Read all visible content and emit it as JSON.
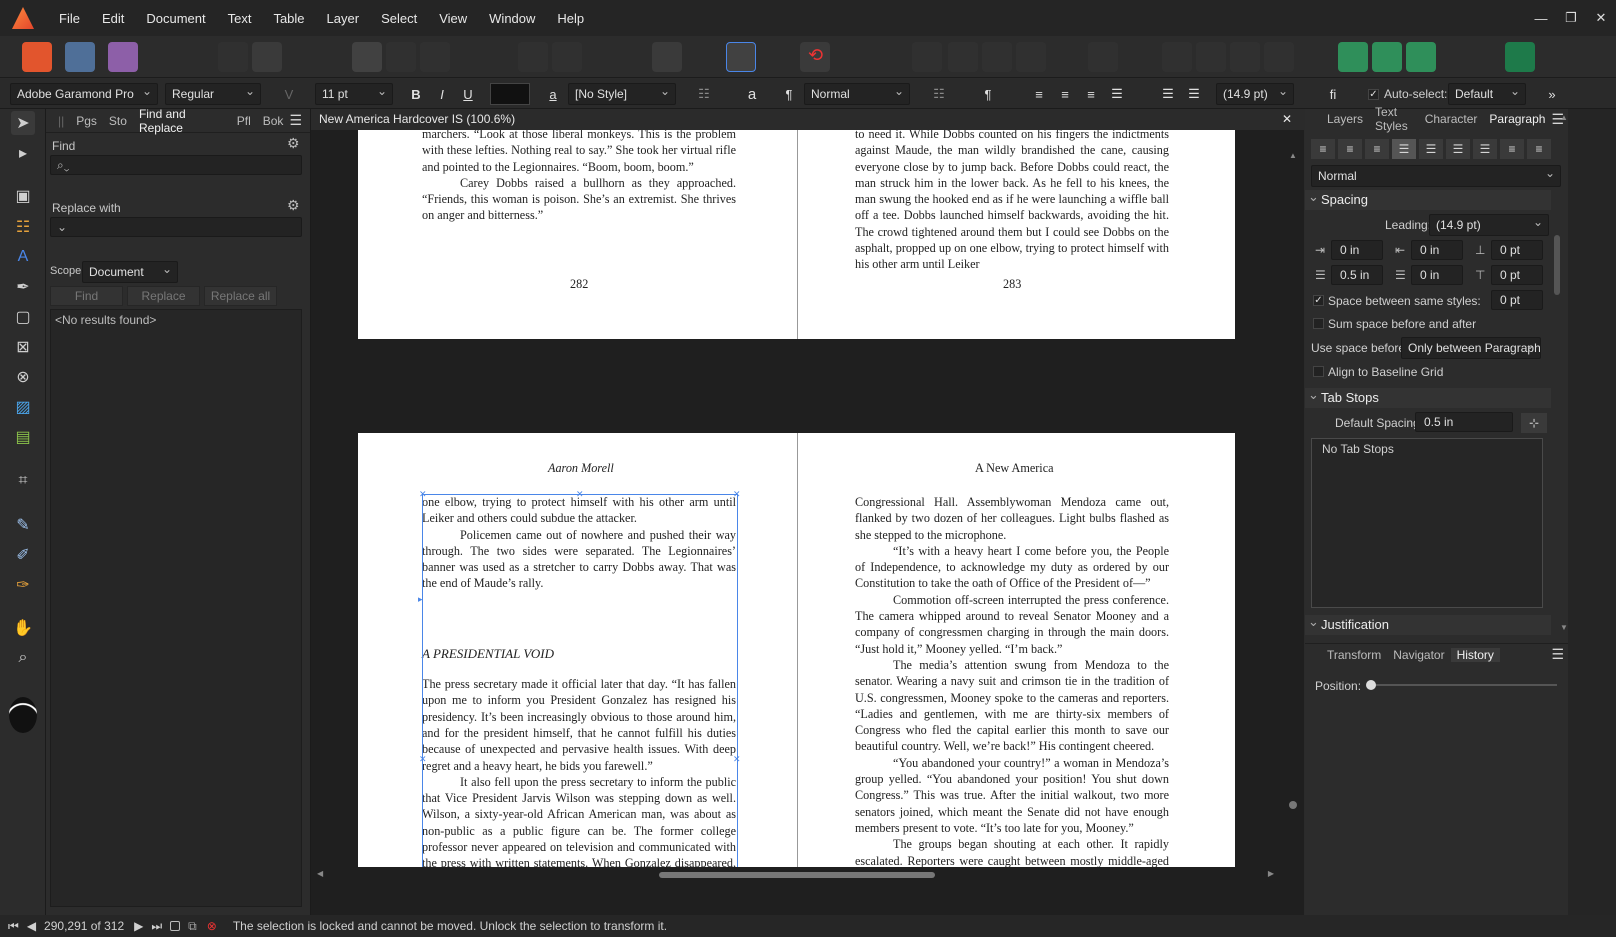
{
  "menu": [
    "File",
    "Edit",
    "Document",
    "Text",
    "Table",
    "Layer",
    "Select",
    "View",
    "Window",
    "Help"
  ],
  "context_bar": {
    "font_family": "Adobe Garamond Pro",
    "font_style": "Regular",
    "font_size": "11 pt",
    "bold": "B",
    "italic": "I",
    "underline": "U",
    "text_color": "#111111",
    "char_style_glyph": "a",
    "char_style": "[No Style]",
    "baseline_glyph": "a",
    "pilcrow": "¶",
    "para_style": "Normal",
    "leading": "(14.9 pt)",
    "ligature": "fi",
    "autoselect_label": "Auto-select:",
    "autoselect_value": "Default"
  },
  "left_panel": {
    "tabs": [
      "Pgs",
      "Sto",
      "Find and Replace",
      "Pfl",
      "Bok"
    ],
    "find_label": "Find",
    "replace_label": "Replace with",
    "scope_label": "Scope:",
    "scope_value": "Document",
    "find_button": "Find",
    "replace_button": "Replace",
    "replace_all_button": "Replace all",
    "results": "<No results found>"
  },
  "document": {
    "title": "New America Hardcover IS (100.6%)",
    "spread1": {
      "left_text": [
        "marchers. “Look at those liberal monkeys. This is the problem with these lefties. Nothing real to say.” She took her virtual rifle and pointed to the Legionnaires. “Boom, boom, boom.”",
        "Carey Dobbs raised a bullhorn as they approached. “Friends, this woman is poison. She’s an extremist. She thrives on anger and bitterness.”"
      ],
      "left_folio": "282",
      "right_text": [
        "to need it. While Dobbs counted on his fingers the indictments against Maude, the man wildly brandished the cane, causing everyone close by to jump back. Before Dobbs could react, the man struck him in the lower back. As he fell to his knees, the man swung the hooked end as if he were launching a wiffle ball off a tee. Dobbs launched himself backwards, avoiding the hit. The crowd tightened around them but I could see Dobbs on the asphalt, propped up on one elbow, trying to protect himself with his other arm until Leiker"
      ],
      "right_folio": "283"
    },
    "spread2": {
      "left_header": "Aaron Morell",
      "left_text": [
        "one elbow, trying to protect himself with his other arm until Leiker and others could subdue the attacker.",
        "Policemen came out of nowhere and pushed their way through. The two sides were separated. The Legionnaires’ banner was used as a stretcher to carry Dobbs away. That was the end of Maude’s rally."
      ],
      "left_heading": "A PRESIDENTIAL VOID",
      "left_text2": [
        "The press secretary made it official later that day. “It has fallen upon me to inform you President Gonzalez has resigned his presidency. It’s been increasingly obvious to those around him, and for the president himself, that he cannot fulfill his duties because of unexpected and pervasive health issues. With deep regret and a heavy heart, he bids you farewell.”",
        "It also fell upon the press secretary to inform the public that Vice President Jarvis Wilson was stepping down as well. Wilson, a sixty-year-old African American man, was about as non-public as a public figure can be. The former college professor never appeared on television and communicated with the press with written statements. When Gonzalez disappeared, so did Wilson."
      ],
      "right_header": "A New America",
      "right_text": [
        "Congressional Hall. Assemblywoman Mendoza came out, flanked by two dozen of her colleagues. Light bulbs flashed as she stepped to the microphone.",
        "“It’s with a heavy heart I come before you, the People of Independence, to acknowledge my duty as ordered by our Constitution to take the oath of Office of the President of—”",
        "Commotion off-screen interrupted the press conference. The camera whipped around to reveal Senator Mooney and a company of congressmen charging in through the main doors. “Just hold it,” Mooney yelled. “I’m back.”",
        "The media’s attention swung from Mendoza to the senator. Wearing a navy suit and crimson tie in the tradition of U.S. congressmen, Mooney spoke to the cameras and reporters. “Ladies and gentlemen, with me are thirty-six members of Congress who fled the capital earlier this month to save our beautiful country. Well, we’re back!” His contingent cheered.",
        "“You abandoned your country!” a woman in Mendoza’s group yelled. “You abandoned your position! You shut down Congress.” This was true. After the initial walkout, two more senators joined, which meant the Senate did not have enough members present to vote. “It’s too late for you, Mooney.”",
        "The groups began shouting at each other. It rapidly escalated. Reporters were caught between mostly middle-aged men as they"
      ]
    }
  },
  "right_panel": {
    "tabs": [
      "Layers",
      "Text Styles",
      "Character",
      "Paragraph"
    ],
    "para_style": "Normal",
    "spacing_title": "Spacing",
    "leading_label": "Leading:",
    "leading_value": "(14.9 pt)",
    "left_indent": "0 in",
    "first_indent": "0 in",
    "space_before": "0 pt",
    "right_indent": "0.5 in",
    "last_indent": "0 in",
    "space_after": "0 pt",
    "space_same_label": "Space between same styles:",
    "space_same_value": "0 pt",
    "sum_space_label": "Sum space before and after",
    "use_space_label": "Use space before:",
    "use_space_value": "Only between Paragraphs",
    "baseline_label": "Align to Baseline Grid",
    "tabstops_title": "Tab Stops",
    "default_spacing_label": "Default Spacing:",
    "default_spacing_value": "0.5 in",
    "no_tab_stops": "No Tab Stops",
    "justification_title": "Justification",
    "bottom_tabs": [
      "Transform",
      "Navigator",
      "History"
    ],
    "position_label": "Position:"
  },
  "status": {
    "pages": "290,291 of 312",
    "message": "The selection is locked and cannot be moved. Unlock the selection to transform it."
  }
}
